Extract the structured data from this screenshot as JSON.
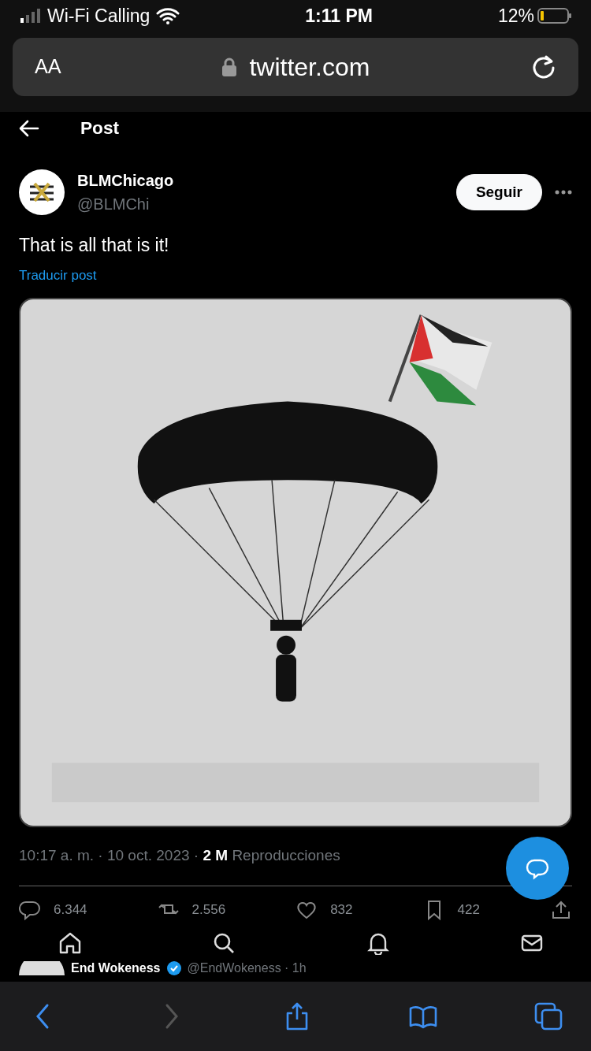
{
  "status_bar": {
    "carrier": "Wi-Fi Calling",
    "time": "1:11 PM",
    "battery": "12%"
  },
  "browser": {
    "text_size": "AA",
    "url": "twitter.com"
  },
  "header": {
    "title": "Post"
  },
  "post": {
    "author": "BLMChicago",
    "handle": "@BLMChi",
    "follow_button": "Seguir",
    "text": "That is all that is it!",
    "translate_link": "Traducir post",
    "meta": "10:17 a. m. · 10 oct. 2023 · **2 M** Reproducciones"
  },
  "actions": [
    {
      "kind": "reply",
      "count": "6.344"
    },
    {
      "kind": "repost",
      "count": "2.556"
    },
    {
      "kind": "like",
      "count": "832"
    },
    {
      "kind": "bookmark",
      "count": "422"
    },
    {
      "kind": "share"
    }
  ],
  "tab_bar": [
    {
      "kind": "home"
    },
    {
      "kind": "search"
    },
    {
      "kind": "notifications"
    },
    {
      "kind": "messages"
    }
  ],
  "next_post": {
    "author": "End Wokeness",
    "verified": true,
    "handle": "@EndWokeness · 1h"
  },
  "safari_toolbar": [
    {
      "kind": "back",
      "disabled": false
    },
    {
      "kind": "forward",
      "disabled": true
    },
    {
      "kind": "share",
      "disabled": false
    },
    {
      "kind": "bookmarks",
      "disabled": false
    },
    {
      "kind": "tabs",
      "disabled": false
    }
  ]
}
